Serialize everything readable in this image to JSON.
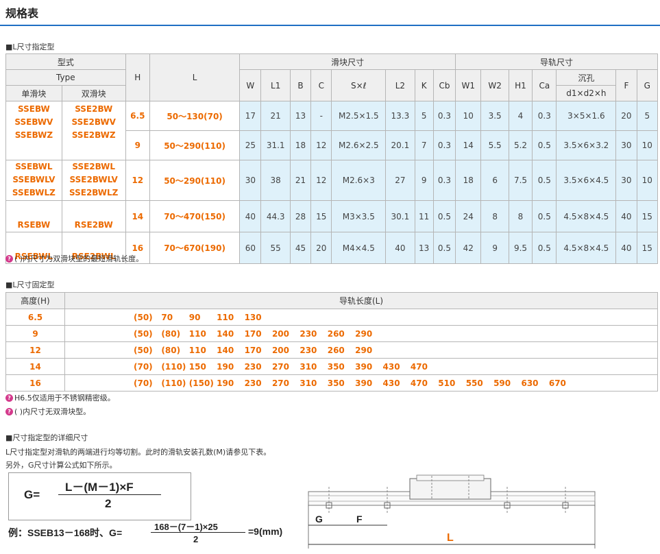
{
  "title": "规格表",
  "section1": {
    "label": "■L尺寸指定型",
    "header": {
      "model": "型式",
      "type": "Type",
      "single": "单滑块",
      "double": "双滑块",
      "H": "H",
      "L": "L",
      "block_dims": "滑块尺寸",
      "rail_dims": "导轨尺寸",
      "W": "W",
      "L1": "L1",
      "B": "B",
      "C": "C",
      "Sxl": "S×ℓ",
      "L2": "L2",
      "K": "K",
      "Cb": "Cb",
      "W1": "W1",
      "W2": "W2",
      "H1": "H1",
      "Ca": "Ca",
      "counterbore": "沉孔",
      "d1d2h": "d1×d2×h",
      "F": "F",
      "G": "G"
    },
    "rows": [
      {
        "single": [
          "SSEBW",
          "SSEBWV",
          "SSEBWZ"
        ],
        "double": [
          "SSE2BW",
          "SSE2BWV",
          "SSE2BWZ"
        ],
        "H": "6.5",
        "L": "50～130(70)",
        "W": "17",
        "L1": "21",
        "B": "13",
        "C": "-",
        "Sxl": "M2.5×1.5",
        "L2": "13.3",
        "K": "5",
        "Cb": "0.3",
        "W1": "10",
        "W2": "3.5",
        "H1": "4",
        "Ca": "0.3",
        "d": "3×5×1.6",
        "F": "20",
        "G": "5"
      },
      {
        "H": "9",
        "L": "50～290(110)",
        "W": "25",
        "L1": "31.1",
        "B": "18",
        "C": "12",
        "Sxl": "M2.6×2.5",
        "L2": "20.1",
        "K": "7",
        "Cb": "0.3",
        "W1": "14",
        "W2": "5.5",
        "H1": "5.2",
        "Ca": "0.5",
        "d": "3.5×6×3.2",
        "F": "30",
        "G": "10"
      },
      {
        "single": [
          "SSEBWL",
          "SSEBWLV",
          "SSEBWLZ"
        ],
        "double": [
          "SSE2BWL",
          "SSE2BWLV",
          "SSE2BWLZ"
        ],
        "H": "12",
        "L": "50～290(110)",
        "W": "30",
        "L1": "38",
        "B": "21",
        "C": "12",
        "Sxl": "M2.6×3",
        "L2": "27",
        "K": "9",
        "Cb": "0.3",
        "W1": "18",
        "W2": "6",
        "H1": "7.5",
        "Ca": "0.5",
        "d": "3.5×6×4.5",
        "F": "30",
        "G": "10"
      },
      {
        "single": [
          "RSEBW"
        ],
        "double": [
          "RSE2BW"
        ],
        "H": "14",
        "L": "70～470(150)",
        "W": "40",
        "L1": "44.3",
        "B": "28",
        "C": "15",
        "Sxl": "M3×3.5",
        "L2": "30.1",
        "K": "11",
        "Cb": "0.5",
        "W1": "24",
        "W2": "8",
        "H1": "8",
        "Ca": "0.5",
        "d": "4.5×8×4.5",
        "F": "40",
        "G": "15"
      },
      {
        "single": [
          "RSEBWL"
        ],
        "double": [
          "RSE2BWL"
        ],
        "H": "16",
        "L": "70～670(190)",
        "W": "60",
        "L1": "55",
        "B": "45",
        "C": "20",
        "Sxl": "M4×4.5",
        "L2": "40",
        "K": "13",
        "Cb": "0.5",
        "W1": "42",
        "W2": "9",
        "H1": "9.5",
        "Ca": "0.5",
        "d": "4.5×8×4.5",
        "F": "40",
        "G": "15"
      }
    ],
    "note": "(  )内尺寸为双滑块型的最短滑轨长度。"
  },
  "section2": {
    "label": "■L尺寸固定型",
    "header_h": "高度(H)",
    "header_l": "导轨长度(L)",
    "rows": [
      {
        "h": "6.5",
        "lengths": [
          "(50)",
          "70",
          "90",
          "110",
          "130"
        ]
      },
      {
        "h": "9",
        "lengths": [
          "(50)",
          "(80)",
          "110",
          "140",
          "170",
          "200",
          "230",
          "260",
          "290"
        ]
      },
      {
        "h": "12",
        "lengths": [
          "(50)",
          "(80)",
          "110",
          "140",
          "170",
          "200",
          "230",
          "260",
          "290"
        ]
      },
      {
        "h": "14",
        "lengths": [
          "(70)",
          "(110)",
          "150",
          "190",
          "230",
          "270",
          "310",
          "350",
          "390",
          "430",
          "470"
        ]
      },
      {
        "h": "16",
        "lengths": [
          "(70)",
          "(110)",
          "(150)",
          "190",
          "230",
          "270",
          "310",
          "350",
          "390",
          "430",
          "470",
          "510",
          "550",
          "590",
          "630",
          "670"
        ]
      }
    ],
    "note1": "H6.5仅适用于不锈钢精密级。",
    "note2": "(  )内尺寸无双滑块型。"
  },
  "section3": {
    "label": "■尺寸指定型的详细尺寸",
    "line1": "L尺寸指定型对滑轨的两端进行均等切割。此时的滑轨安装孔数(M)请参见下表。",
    "line2": "另外，G尺寸计算公式如下所示。",
    "formula_lhs": "G=",
    "formula_num": "L－(M－1)×F",
    "formula_den": "2",
    "example_prefix": "例：SSEB13－168时、G=",
    "example_num": "168－(7－1)×25",
    "example_den": "2",
    "example_result": "=9(mm)",
    "dim_G": "G",
    "dim_F": "F",
    "dim_L": "L"
  },
  "colors": {
    "accent_orange": "#ec6a00",
    "header_blue": "#1f6fc4",
    "cell_blue": "#dff1fa",
    "note_icon": "#d43a8c"
  }
}
